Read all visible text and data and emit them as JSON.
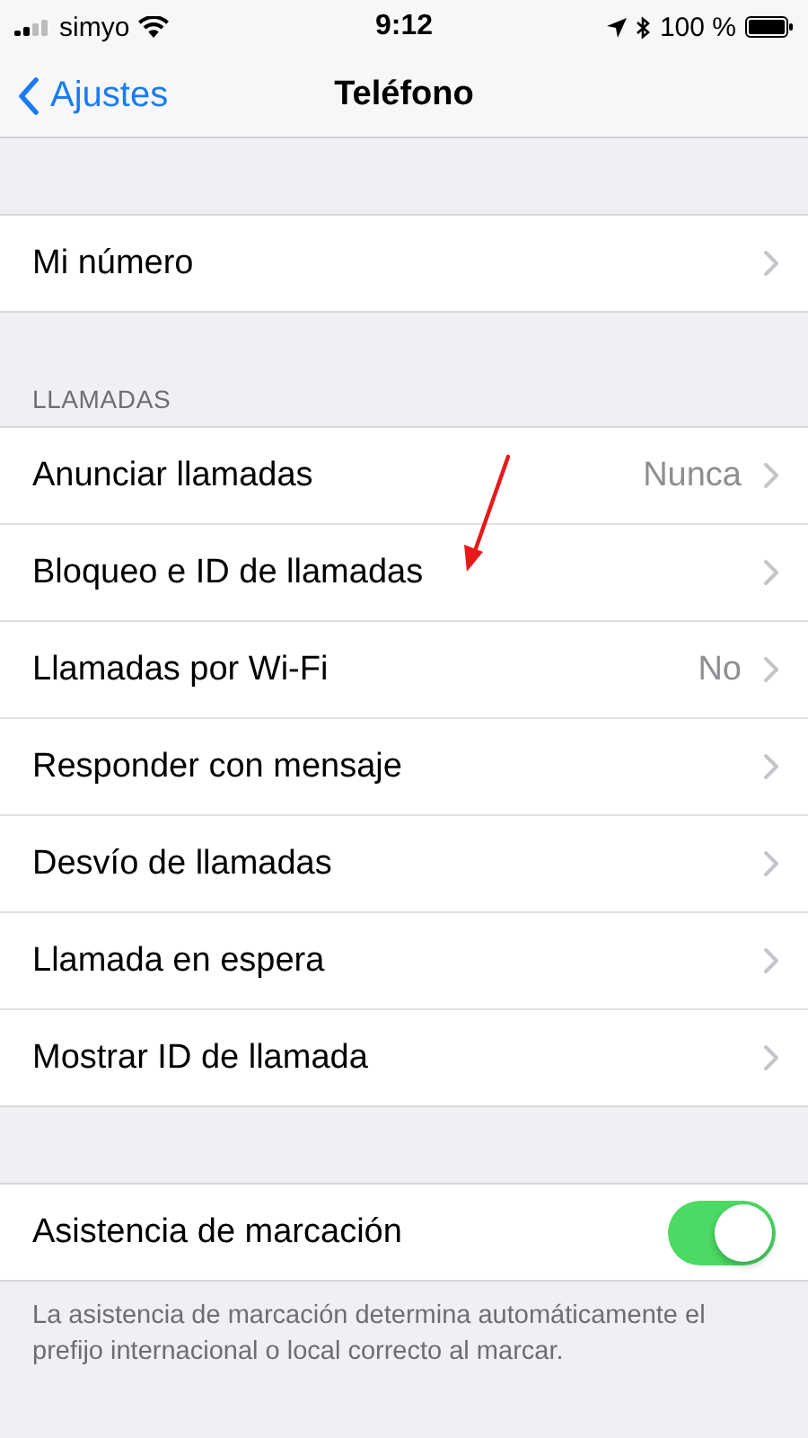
{
  "status_bar": {
    "carrier": "simyo",
    "time": "9:12",
    "battery_text": "100 %"
  },
  "nav": {
    "back": "Ajustes",
    "title": "Teléfono"
  },
  "sections": [
    {
      "rows": [
        {
          "label": "Mi número",
          "kind": "link"
        }
      ]
    },
    {
      "header": "LLAMADAS",
      "rows": [
        {
          "label": "Anunciar llamadas",
          "value": "Nunca",
          "kind": "link"
        },
        {
          "label": "Bloqueo e ID de llamadas",
          "kind": "link"
        },
        {
          "label": "Llamadas por Wi-Fi",
          "value": "No",
          "kind": "link"
        },
        {
          "label": "Responder con mensaje",
          "kind": "link"
        },
        {
          "label": "Desvío de llamadas",
          "kind": "link"
        },
        {
          "label": "Llamada en espera",
          "kind": "link"
        },
        {
          "label": "Mostrar ID de llamada",
          "kind": "link"
        }
      ]
    },
    {
      "rows": [
        {
          "label": "Asistencia de marcación",
          "kind": "toggle",
          "on": true
        }
      ],
      "footer": "La asistencia de marcación determina automáticamente el prefijo internacional o local correcto al marcar."
    }
  ],
  "annotations": [
    {
      "kind": "arrow"
    }
  ]
}
